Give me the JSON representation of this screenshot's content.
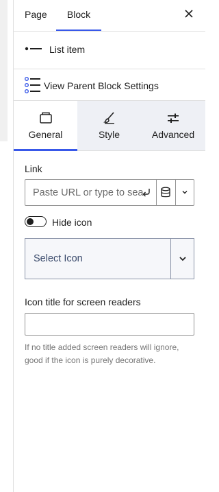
{
  "header": {
    "tab_page": "Page",
    "tab_block": "Block"
  },
  "block": {
    "name": "List item"
  },
  "parent_link": {
    "label": "View Parent Block Settings"
  },
  "settings_tabs": [
    {
      "label": "General",
      "icon": "panel-icon",
      "active": true
    },
    {
      "label": "Style",
      "icon": "brush-icon",
      "active": false
    },
    {
      "label": "Advanced",
      "icon": "sliders-icon",
      "active": false
    }
  ],
  "link": {
    "label": "Link",
    "placeholder": "Paste URL or type to search"
  },
  "hide_icon": {
    "label": "Hide icon",
    "checked": false
  },
  "icon_select": {
    "placeholder": "Select Icon"
  },
  "icon_title": {
    "label": "Icon title for screen readers",
    "value": "",
    "help": "If no title added screen readers will ignore, good if the icon is purely decorative."
  },
  "colors": {
    "accent": "#3858e9",
    "tab_inactive_bg": "#eef0f5"
  }
}
